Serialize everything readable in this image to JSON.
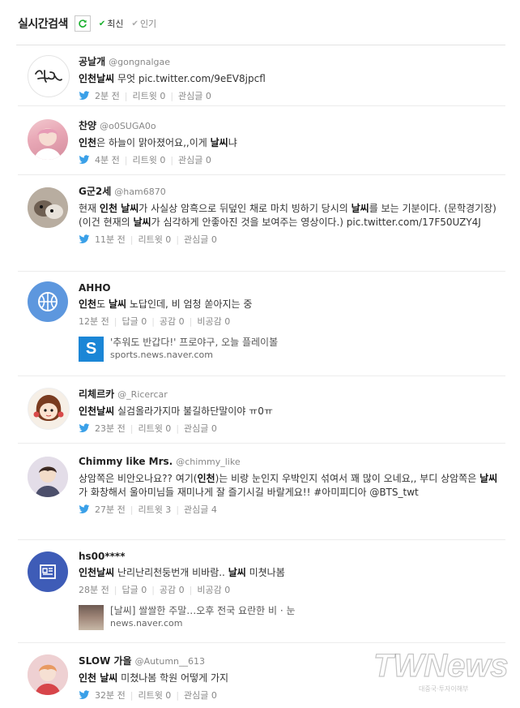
{
  "header": {
    "title": "실시간검색",
    "tab_latest": "최신",
    "tab_popular": "인기"
  },
  "colors": {
    "accent_green": "#19b02d",
    "twitter_blue": "#3aa0e8",
    "naver_blue": "#1b86d6"
  },
  "items": [
    {
      "name": "공날개",
      "handle": "@gongnalgae",
      "text_parts": [
        {
          "b": "인천날씨"
        },
        {
          "t": " 무엇 pic.twitter.com/9eEV8jpcfl"
        }
      ],
      "time": "2분 전",
      "m1": "리트윗 0",
      "m2": "관심글 0",
      "avatar_icon": "handwritten-logo-avatar"
    },
    {
      "name": "찬양",
      "handle": "@o0SUGA0o",
      "text_parts": [
        {
          "b": "인천"
        },
        {
          "t": "은 하늘이 맑아졌어요,,이게 "
        },
        {
          "b": "날씨"
        },
        {
          "t": "냐"
        }
      ],
      "time": "4분 전",
      "m1": "리트윗 0",
      "m2": "관심글 0",
      "avatar_icon": "person-photo-avatar"
    },
    {
      "name": "G군2세",
      "handle": "@ham6870",
      "text_parts": [
        {
          "t": "현재 "
        },
        {
          "b": "인천 날씨"
        },
        {
          "t": "가 사실상 암흑으로 뒤덮인 채로 마치 빙하기 당시의 "
        },
        {
          "b": "날씨"
        },
        {
          "t": "를 보는 기분이다. (문학경기장)(이건 현재의 "
        },
        {
          "b": "날씨"
        },
        {
          "t": "가 심각하게 안좋아진 것을 보여주는 영상이다.) pic.twitter.com/17F50UZY4J"
        }
      ],
      "time": "11분 전",
      "m1": "리트윗 0",
      "m2": "관심글 0",
      "avatar_icon": "animal-photo-avatar"
    },
    {
      "name": "AHHO",
      "handle": "",
      "text_parts": [
        {
          "b": "인천"
        },
        {
          "t": "도 "
        },
        {
          "b": "날씨"
        },
        {
          "t": " 노답인데, 비 엄청 쏟아지는 중"
        }
      ],
      "time": "12분 전",
      "m1": "답글 0",
      "m2": "공감 0",
      "m3": "비공감 0",
      "news_title": "'추워도 반갑다!' 프로야구, 오늘 플레이볼",
      "news_src": "sports.news.naver.com",
      "avatar_icon": "basketball-icon"
    },
    {
      "name": "리체르카",
      "handle": "@_Ricercar",
      "text_parts": [
        {
          "b": "인천날씨"
        },
        {
          "t": " 실검올라가지마 불길하단말이야 ㅠ0ㅠ"
        }
      ],
      "time": "23분 전",
      "m1": "리트윗 0",
      "m2": "관심글 0",
      "avatar_icon": "cartoon-character-avatar"
    },
    {
      "name": "Chimmy like Mrs.",
      "handle": "@chimmy_like",
      "text_parts": [
        {
          "t": "상암쪽은 비안오나요?? 여기("
        },
        {
          "b": "인천"
        },
        {
          "t": ")는 비랑 눈인지 우박인지 섞여서 꽤 많이 오네요,, 부디 상암쪽은 "
        },
        {
          "b": "날씨"
        },
        {
          "t": "가 화창해서 울아미님들 재미나게 잘 즐기시길 바랄게요!! #아미피디아 @BTS_twt"
        }
      ],
      "time": "27분 전",
      "m1": "리트윗 3",
      "m2": "관심글 4",
      "avatar_icon": "person-photo-avatar"
    },
    {
      "name": "hs00****",
      "handle": "",
      "text_parts": [
        {
          "b": "인천날씨"
        },
        {
          "t": " 난리난리천둥번개 비바람.. "
        },
        {
          "b": "날씨"
        },
        {
          "t": " 미쳣나봄"
        }
      ],
      "time": "28분 전",
      "m1": "답글 0",
      "m2": "공감 0",
      "m3": "비공감 0",
      "news_title": "[날씨] 쌀쌀한 주말…오후 전국 요란한 비 · 눈",
      "news_src": "news.naver.com",
      "avatar_icon": "news-icon"
    },
    {
      "name": "SLOW 가을",
      "handle": "@Autumn__613",
      "text_parts": [
        {
          "b": "인천 날씨"
        },
        {
          "t": " 미쳤나봄 학원 어떻게 가지"
        }
      ],
      "time": "32분 전",
      "m1": "리트윗 0",
      "m2": "관심글 0",
      "avatar_icon": "person-photo-avatar"
    }
  ],
  "watermark": {
    "text": "TWNews",
    "sub": "대중국·투자이해부"
  }
}
